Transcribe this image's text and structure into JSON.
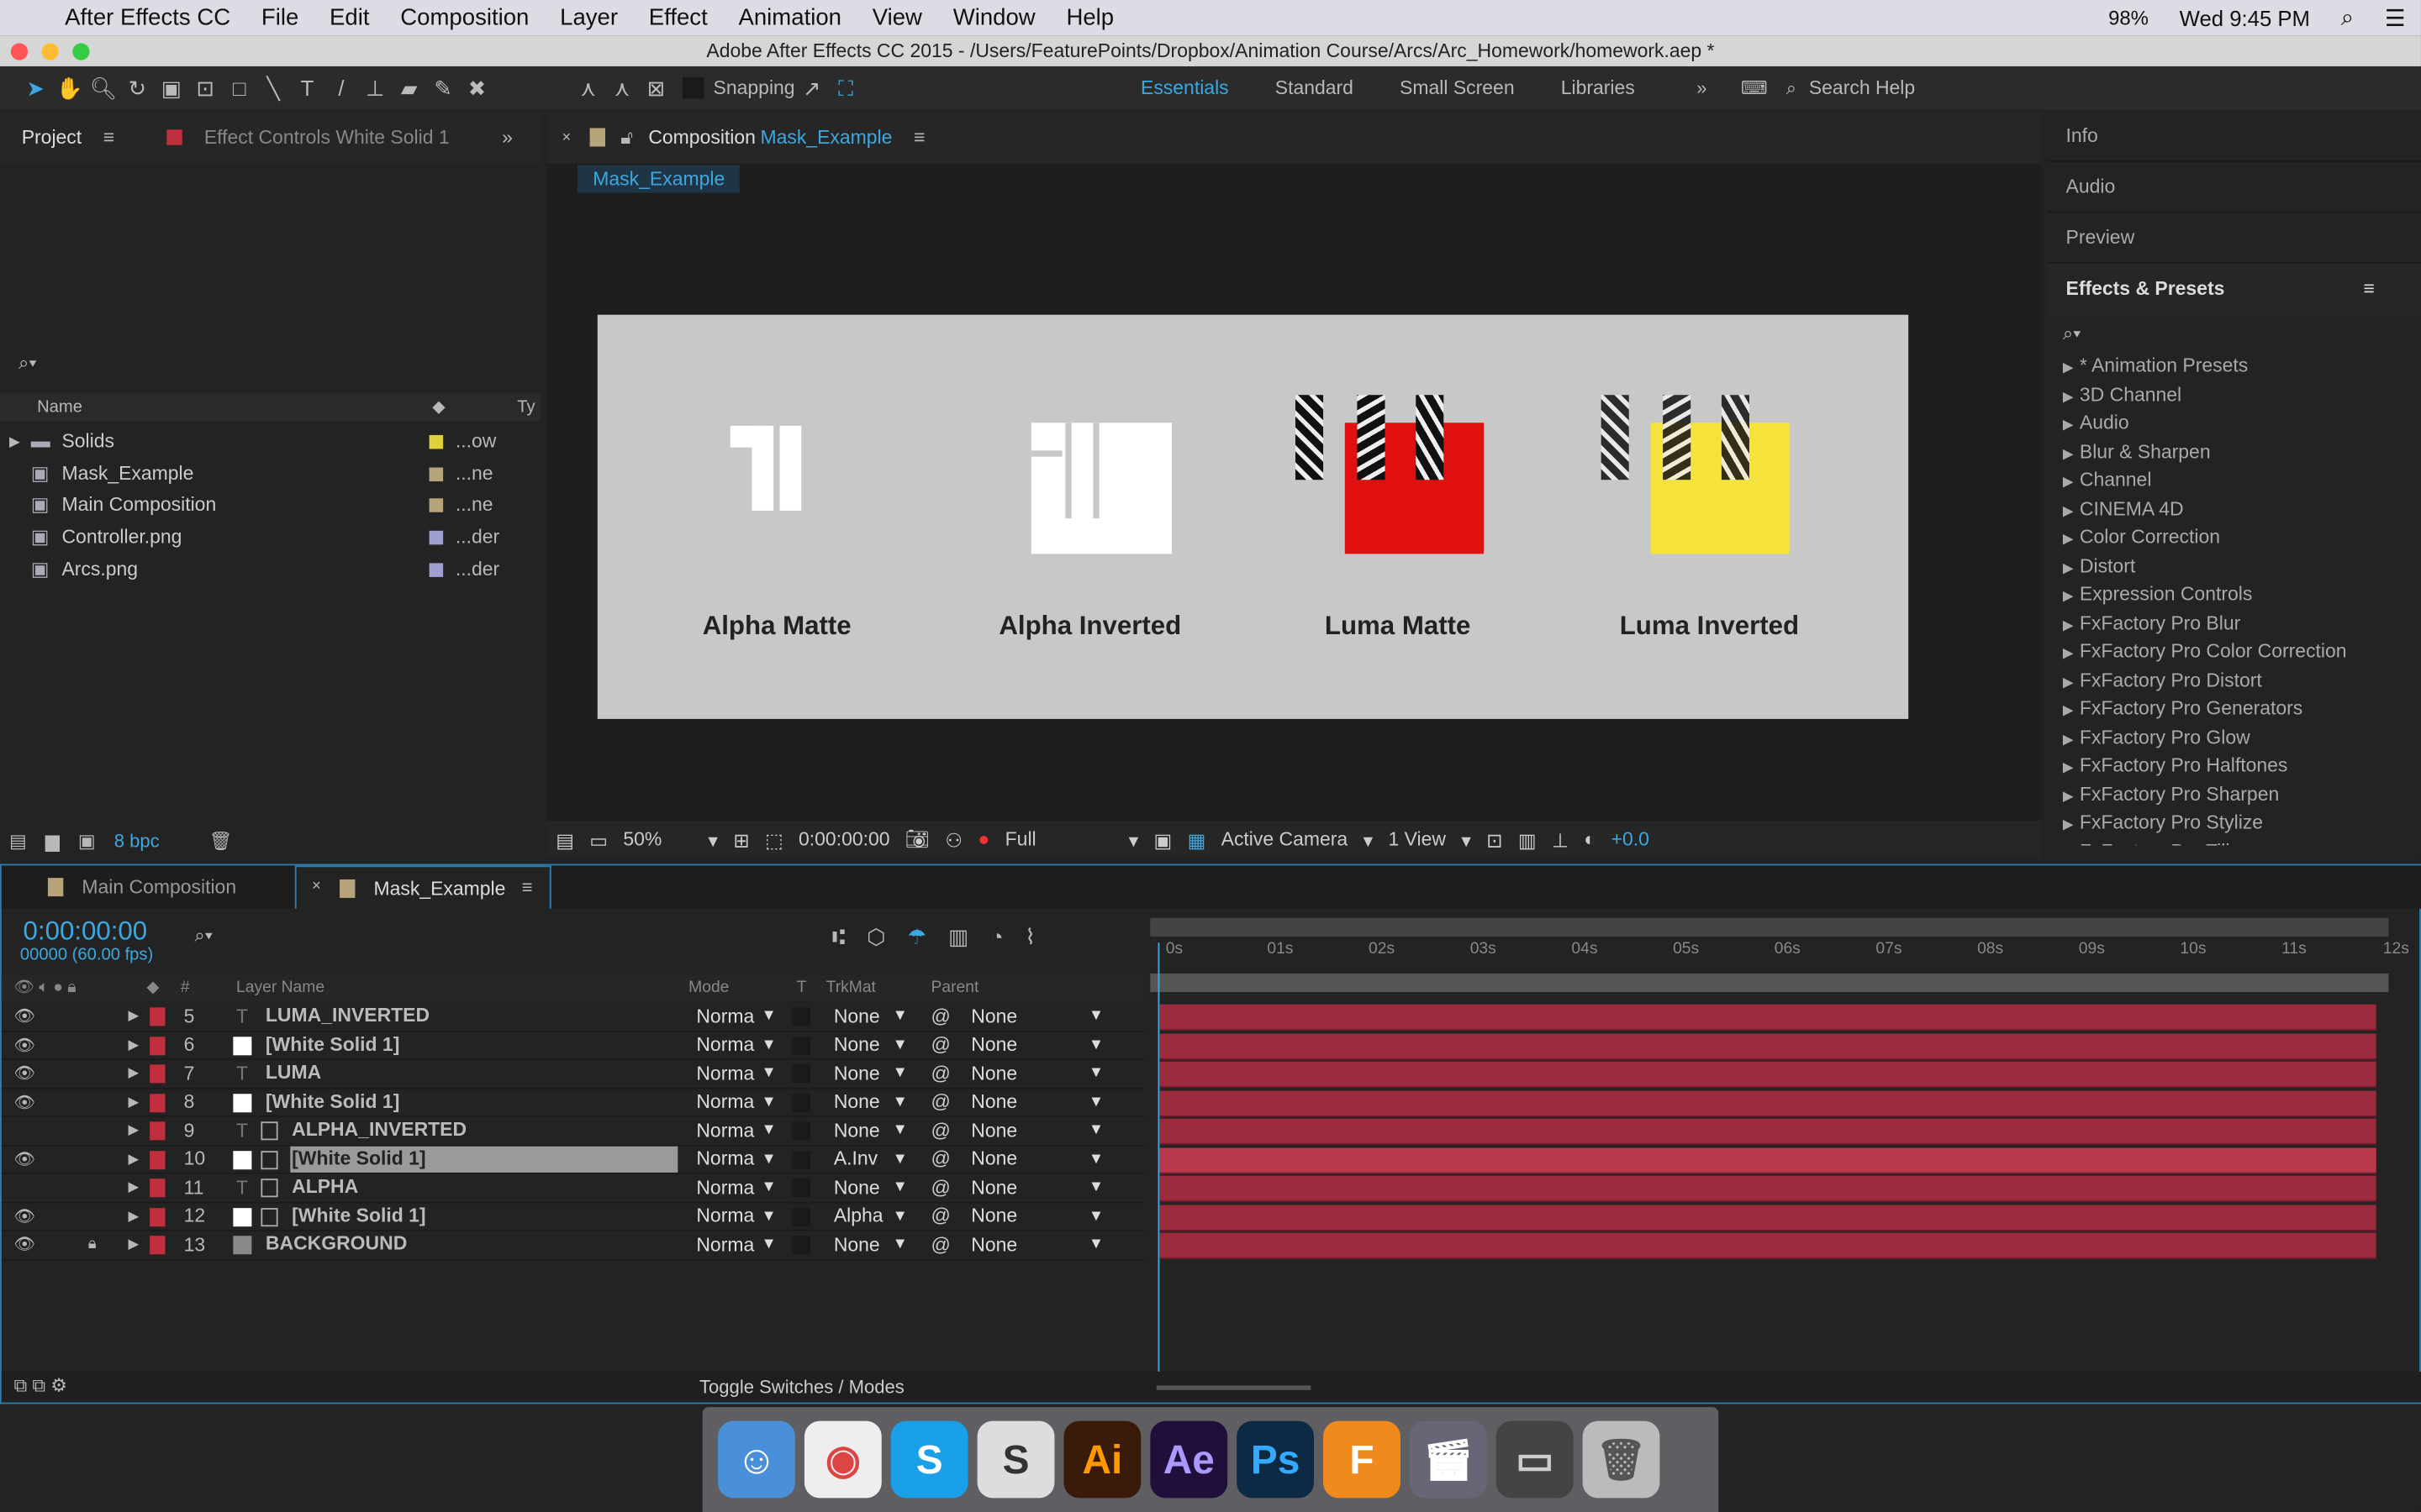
{
  "menubar": {
    "app": "After Effects CC",
    "items": [
      "File",
      "Edit",
      "Composition",
      "Layer",
      "Effect",
      "Animation",
      "View",
      "Window",
      "Help"
    ],
    "battery": "98%",
    "clock": "Wed 9:45 PM"
  },
  "window_title": "Adobe After Effects CC 2015 - /Users/FeaturePoints/Dropbox/Animation Course/Arcs/Arc_Homework/homework.aep *",
  "toolbar": {
    "snapping": "Snapping",
    "workspaces": [
      "Essentials",
      "Standard",
      "Small Screen",
      "Libraries"
    ],
    "search_help": "Search Help"
  },
  "project": {
    "tab": "Project",
    "effect_controls_tab": "Effect Controls White Solid 1",
    "col_name": "Name",
    "col_type": "Ty",
    "bpc": "8 bpc",
    "items": [
      {
        "name": "Solids",
        "type": "...ow",
        "color": "#e0d040",
        "icon": "folder-icon"
      },
      {
        "name": "Mask_Example",
        "type": "...ne",
        "color": "#b8a47a",
        "icon": "composition-icon"
      },
      {
        "name": "Main Composition",
        "type": "...ne",
        "color": "#b8a47a",
        "icon": "composition-icon"
      },
      {
        "name": "Controller.png",
        "type": "...der",
        "color": "#a0a0d0",
        "icon": "image-icon"
      },
      {
        "name": "Arcs.png",
        "type": "...der",
        "color": "#a0a0d0",
        "icon": "image-icon"
      }
    ]
  },
  "composition": {
    "tab_prefix": "Composition",
    "tab_name": "Mask_Example",
    "flow_tab": "Mask_Example",
    "labels": [
      "Alpha Matte",
      "Alpha Inverted",
      "Luma Matte",
      "Luma Inverted"
    ],
    "footer": {
      "zoom": "50%",
      "timecode": "0:00:00:00",
      "resolution": "Full",
      "camera": "Active Camera",
      "views": "1 View",
      "exposure": "+0.0"
    }
  },
  "right_panel": {
    "sections": [
      "Info",
      "Audio",
      "Preview"
    ],
    "effects_title": "Effects & Presets",
    "effects": [
      "* Animation Presets",
      "3D Channel",
      "Audio",
      "Blur & Sharpen",
      "Channel",
      "CINEMA 4D",
      "Color Correction",
      "Distort",
      "Expression Controls",
      "FxFactory Pro Blur",
      "FxFactory Pro Color Correction",
      "FxFactory Pro Distort",
      "FxFactory Pro Generators",
      "FxFactory Pro Glow",
      "FxFactory Pro Halftones",
      "FxFactory Pro Sharpen",
      "FxFactory Pro Stylize",
      "FxFactory Pro Tiling"
    ]
  },
  "timeline": {
    "tabs": [
      "Main Composition",
      "Mask_Example"
    ],
    "timecode": "0:00:00:00",
    "frames": "00000 (60.00 fps)",
    "columns": {
      "num": "#",
      "name": "Layer Name",
      "mode": "Mode",
      "t": "T",
      "trkmat": "TrkMat",
      "parent": "Parent"
    },
    "ruler": [
      "0s",
      "01s",
      "02s",
      "03s",
      "04s",
      "05s",
      "06s",
      "07s",
      "08s",
      "09s",
      "10s",
      "11s",
      "12s"
    ],
    "layers": [
      {
        "num": "5",
        "name": "LUMA_INVERTED",
        "type": "text",
        "mode": "Norma",
        "trkmat": "None",
        "parent": "None",
        "visible": true,
        "locked": false,
        "selected": false
      },
      {
        "num": "6",
        "name": "[White Solid 1]",
        "type": "solid",
        "mode": "Norma",
        "trkmat": "None",
        "parent": "None",
        "visible": true,
        "locked": false,
        "selected": false
      },
      {
        "num": "7",
        "name": "LUMA",
        "type": "text",
        "mode": "Norma",
        "trkmat": "None",
        "parent": "None",
        "visible": true,
        "locked": false,
        "selected": false
      },
      {
        "num": "8",
        "name": "[White Solid 1]",
        "type": "solid",
        "mode": "Norma",
        "trkmat": "None",
        "parent": "None",
        "visible": true,
        "locked": false,
        "selected": false
      },
      {
        "num": "9",
        "name": "ALPHA_INVERTED",
        "type": "text",
        "mode": "Norma",
        "trkmat": "None",
        "parent": "None",
        "visible": false,
        "locked": false,
        "selected": false
      },
      {
        "num": "10",
        "name": "[White Solid 1]",
        "type": "solid",
        "mode": "Norma",
        "trkmat": "A.Inv",
        "parent": "None",
        "visible": true,
        "locked": false,
        "selected": true
      },
      {
        "num": "11",
        "name": "ALPHA",
        "type": "text",
        "mode": "Norma",
        "trkmat": "None",
        "parent": "None",
        "visible": false,
        "locked": false,
        "selected": false
      },
      {
        "num": "12",
        "name": "[White Solid 1]",
        "type": "solid",
        "mode": "Norma",
        "trkmat": "Alpha",
        "parent": "None",
        "visible": true,
        "locked": false,
        "selected": false
      },
      {
        "num": "13",
        "name": "BACKGROUND",
        "type": "solid-gray",
        "mode": "Norma",
        "trkmat": "None",
        "parent": "None",
        "visible": true,
        "locked": true,
        "selected": false
      }
    ],
    "toggle_label": "Toggle Switches / Modes"
  },
  "colors": {
    "accent": "#3da8e0",
    "layer_label": "#c0303c",
    "bar": "#9b2b3c",
    "red_box": "#e01010",
    "yellow_box": "#f5e23a",
    "canvas": "#c8c8c8"
  },
  "dock": [
    "Finder",
    "Chrome",
    "Skype",
    "Slack",
    "Ai",
    "Ae",
    "Ps",
    "F 360",
    "Photo Booth",
    "Screen",
    "Trash"
  ]
}
